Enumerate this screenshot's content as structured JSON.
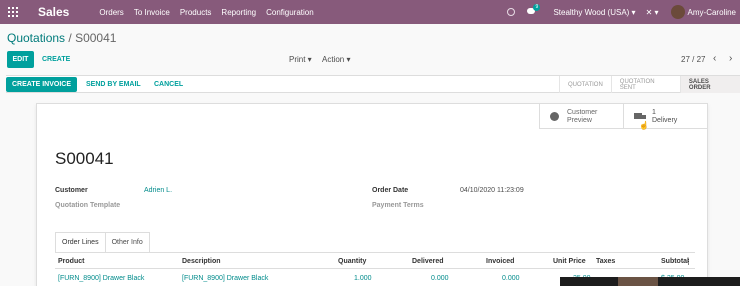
{
  "navbar": {
    "brand": "Sales",
    "menu": [
      "Orders",
      "To Invoice",
      "Products",
      "Reporting",
      "Configuration"
    ],
    "chat_count": "9",
    "company": "Stealthy Wood (USA)",
    "user": "Amy-Caroline"
  },
  "breadcrumb": {
    "parent": "Quotations",
    "separator": "/",
    "current": "S00041"
  },
  "toolbar": {
    "edit": "EDIT",
    "create": "CREATE",
    "print": "Print",
    "action": "Action",
    "pager": "27 / 27"
  },
  "statusbar": {
    "create_invoice": "CREATE INVOICE",
    "send_email": "SEND BY EMAIL",
    "cancel": "CANCEL",
    "stages": [
      "QUOTATION",
      "QUOTATION SENT",
      "SALES ORDER"
    ],
    "active_stage": "SALES ORDER"
  },
  "smart_buttons": {
    "preview_line1": "Customer",
    "preview_line2": "Preview",
    "delivery_count": "1",
    "delivery_label": "Delivery"
  },
  "form": {
    "name": "S00041",
    "customer_label": "Customer",
    "customer_value": "Adrien L.",
    "template_label": "Quotation Template",
    "order_date_label": "Order Date",
    "order_date_value": "04/10/2020 11:23:09",
    "payment_terms_label": "Payment Terms"
  },
  "tabs": [
    "Order Lines",
    "Other Info"
  ],
  "table": {
    "headers": [
      "Product",
      "Description",
      "Quantity",
      "Delivered",
      "Invoiced",
      "Unit Price",
      "Taxes",
      "Subtotal"
    ],
    "rows": [
      {
        "product": "[FURN_8900] Drawer Black",
        "description": "[FURN_8900] Drawer Black",
        "quantity": "1.000",
        "delivered": "0.000",
        "invoiced": "0.000",
        "unit_price": "25.00",
        "taxes": "",
        "subtotal": "$ 25.00"
      }
    ]
  }
}
